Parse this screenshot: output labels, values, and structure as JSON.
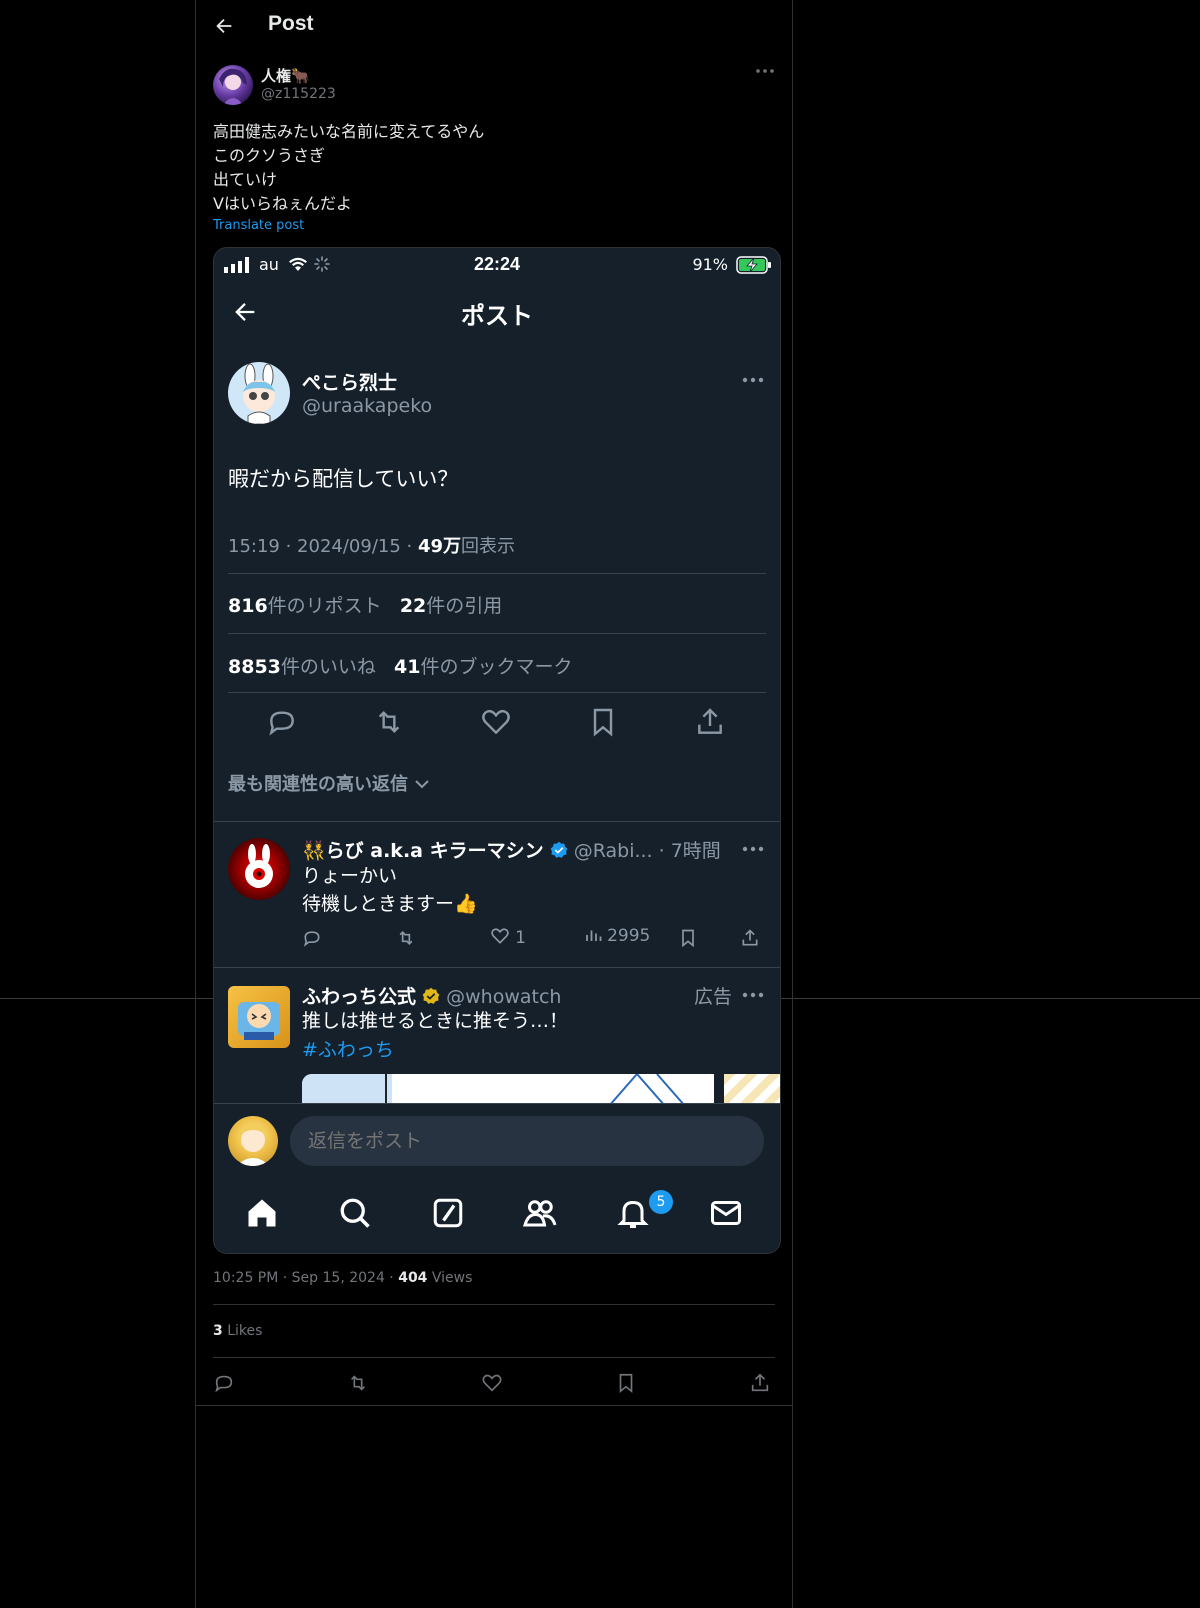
{
  "header": {
    "title": "Post"
  },
  "author": {
    "name": "人権🐂",
    "handle": "@z115223"
  },
  "post": {
    "text": "高田健志みたいな名前に変えてるやん\nこのクソうさぎ\n出ていけ\nVはいらねぇんだよ",
    "translate_label": "Translate post",
    "timestamp": "10:25 PM · Sep 15, 2024 · ",
    "views_count": "404",
    "views_label": " Views",
    "likes_count": "3",
    "likes_label": " Likes"
  },
  "screenshot": {
    "status_bar": {
      "carrier": "au",
      "time": "22:24",
      "battery": "91%"
    },
    "title": "ポスト",
    "original_post": {
      "name": "ぺこら烈士",
      "handle": "@uraakapeko",
      "text": "暇だから配信していい？",
      "meta_time": "15:19 · 2024/09/15 · ",
      "views_count": "49万",
      "views_label": "回表示",
      "reposts_count": "816",
      "reposts_label": "件のリポスト",
      "quotes_count": "22",
      "quotes_label": "件の引用",
      "likes_count": "8853",
      "likes_label": "件のいいね",
      "bookmarks_count": "41",
      "bookmarks_label": "件のブックマーク"
    },
    "sort_label": "最も関連性の高い返信",
    "replies": [
      {
        "name": "👯らび a.k.a キラーマシン",
        "handle": "@Rabi... · 7時間",
        "text": "りょーかい\n待機しときますー👍",
        "likes": "1",
        "views": "2995"
      },
      {
        "name": "ふわっち公式",
        "handle": "@whowatch",
        "ad_label": "広告",
        "text": "推しは推せるときに推そう…！",
        "hashtag": "#ふわっち"
      }
    ],
    "reply_placeholder": "返信をポスト",
    "notification_badge": "5"
  },
  "colors": {
    "accent": "#1d9bf0",
    "bg": "#000000",
    "screenshot_bg": "#15202b",
    "verified_gold": "#e2b719"
  }
}
